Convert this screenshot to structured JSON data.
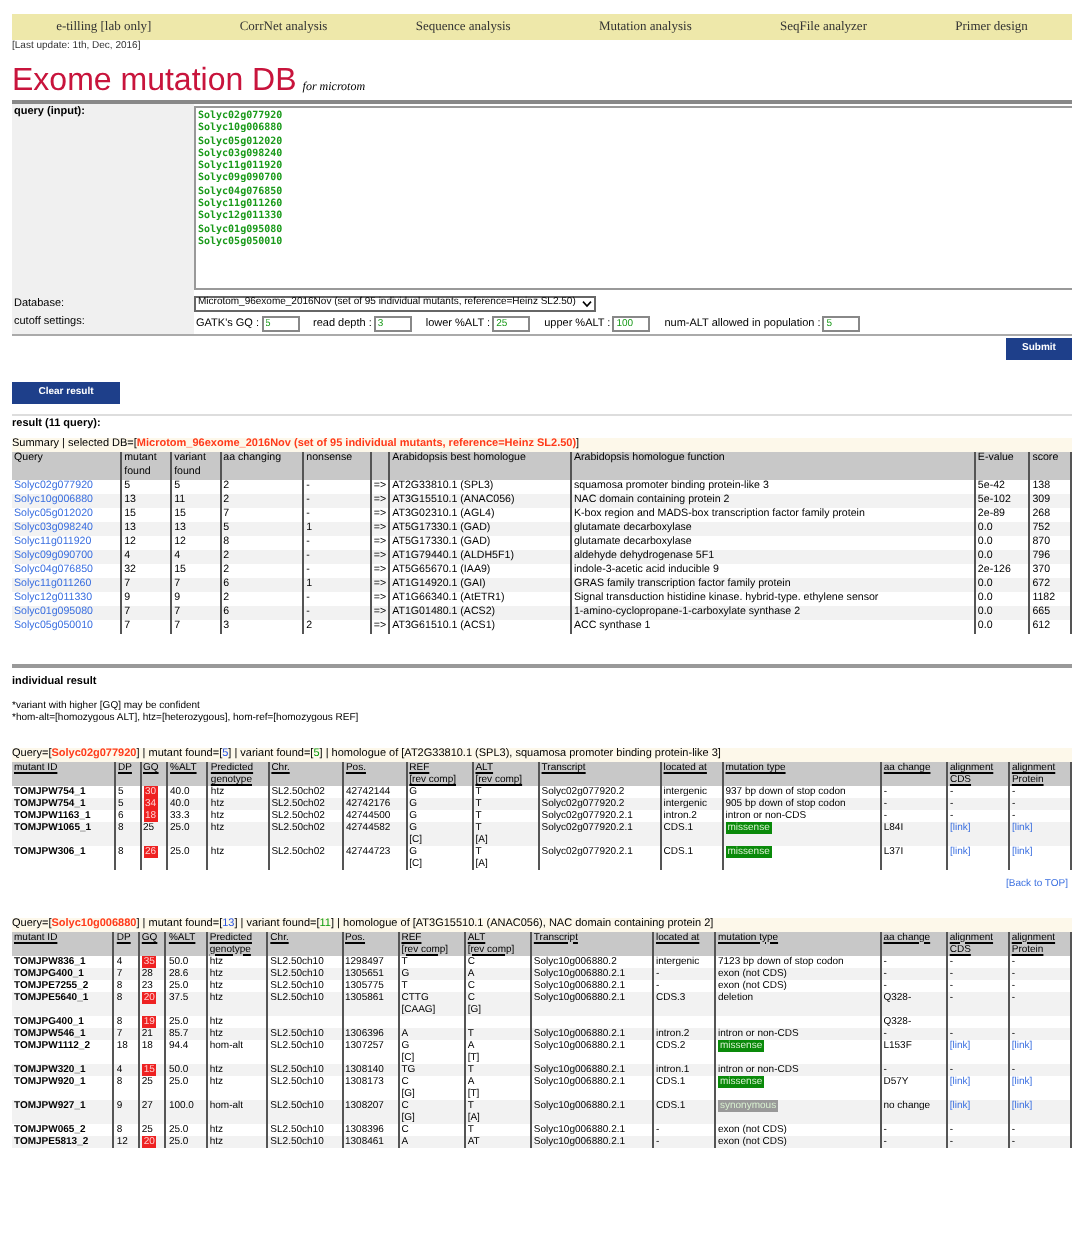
{
  "nav": [
    "e-tilling [lab only]",
    "CorrNet analysis",
    "Sequence analysis",
    "Mutation analysis",
    "SeqFile analyzer",
    "Primer design"
  ],
  "last_update": "[Last update: 1th, Dec, 2016]",
  "title": "Exome mutation DB",
  "subtitle": "for microtom",
  "form": {
    "query_label": "query (input):",
    "query_value": "Solyc02g077920\nSolyc10g006880\nSolyc05g012020\nSolyc03g098240\nSolyc11g011920\nSolyc09g090700\nSolyc04g076850\nSolyc11g011260\nSolyc12g011330\nSolyc01g095080\nSolyc05g050010",
    "database_label": "Database:",
    "database_value": "Microtom_96exome_2016Nov (set of 95 individual mutants, reference=Heinz SL2.50)",
    "cutoff_label": "cutoff settings:",
    "cutoffs": [
      {
        "label": "GATK's GQ :",
        "value": "5"
      },
      {
        "label": "read depth :",
        "value": "3"
      },
      {
        "label": "lower %ALT :",
        "value": "25"
      },
      {
        "label": "upper %ALT :",
        "value": "100"
      },
      {
        "label": "num-ALT allowed in population :",
        "value": "5"
      }
    ],
    "submit": "Submit"
  },
  "clear_button": "Clear result",
  "result_heading": "result (11 query):",
  "summary": {
    "heading": [
      {
        "kind": "plain",
        "text": "Summary | selected DB=["
      },
      {
        "kind": "db",
        "text": "Microtom_96exome_2016Nov (set of 95 individual mutants, reference=Heinz SL2.50)"
      },
      {
        "kind": "plain",
        "text": "]"
      }
    ],
    "columns": [
      "Query",
      "mutant\nfound",
      "variant\nfound",
      "aa changing",
      "nonsense",
      null,
      "Arabidopsis best homologue",
      "Arabidopsis homologue function",
      "E-value",
      "score"
    ],
    "rows": [
      [
        "Solyc02g077920",
        "5",
        "5",
        "2",
        "-",
        "=>",
        "AT2G33810.1 (SPL3)",
        "squamosa promoter binding protein-like 3",
        "5e-42",
        "138"
      ],
      [
        "Solyc10g006880",
        "13",
        "11",
        "2",
        "-",
        "=>",
        "AT3G15510.1 (ANAC056)",
        "NAC domain containing protein 2",
        "5e-102",
        "309"
      ],
      [
        "Solyc05g012020",
        "15",
        "15",
        "7",
        "-",
        "=>",
        "AT3G02310.1 (AGL4)",
        "K-box region and MADS-box transcription factor family protein",
        "2e-89",
        "268"
      ],
      [
        "Solyc03g098240",
        "13",
        "13",
        "5",
        "1",
        "=>",
        "AT5G17330.1 (GAD)",
        "glutamate decarboxylase",
        "0.0",
        "752"
      ],
      [
        "Solyc11g011920",
        "12",
        "12",
        "8",
        "-",
        "=>",
        "AT5G17330.1 (GAD)",
        "glutamate decarboxylase",
        "0.0",
        "870"
      ],
      [
        "Solyc09g090700",
        "4",
        "4",
        "2",
        "-",
        "=>",
        "AT1G79440.1 (ALDH5F1)",
        "aldehyde dehydrogenase 5F1",
        "0.0",
        "796"
      ],
      [
        "Solyc04g076850",
        "32",
        "15",
        "2",
        "-",
        "=>",
        "AT5G65670.1 (IAA9)",
        "indole-3-acetic acid inducible 9",
        "2e-126",
        "370"
      ],
      [
        "Solyc11g011260",
        "7",
        "7",
        "6",
        "1",
        "=>",
        "AT1G14920.1 (GAI)",
        "GRAS family transcription factor family protein",
        "0.0",
        "672"
      ],
      [
        "Solyc12g011330",
        "9",
        "9",
        "2",
        "-",
        "=>",
        "AT1G66340.1 (AtETR1)",
        "Signal transduction histidine kinase. hybrid-type. ethylene sensor",
        "0.0",
        "1182"
      ],
      [
        "Solyc01g095080",
        "7",
        "7",
        "6",
        "-",
        "=>",
        "AT1G01480.1 (ACS2)",
        "1-amino-cyclopropane-1-carboxylate synthase 2",
        "0.0",
        "665"
      ],
      [
        "Solyc05g050010",
        "7",
        "7",
        "3",
        "2",
        "=>",
        "AT3G61510.1 (ACS1)",
        "ACC synthase 1",
        "0.0",
        "612"
      ]
    ]
  },
  "individual": {
    "heading": "individual result",
    "notes": [
      "*variant with higher [GQ] may be confident",
      "*hom-alt=[homozygous ALT], htz=[heterozygous], hom-ref=[homozygous REF]"
    ]
  },
  "queries": [
    {
      "heading": [
        {
          "kind": "plain",
          "text": "Query=["
        },
        {
          "kind": "query",
          "text": "Solyc02g077920"
        },
        {
          "kind": "plain",
          "text": "] | mutant found=["
        },
        {
          "kind": "mutant",
          "text": "5"
        },
        {
          "kind": "plain",
          "text": "] | variant found=["
        },
        {
          "kind": "variant",
          "text": "5"
        },
        {
          "kind": "plain",
          "text": "] | homologue of [AT2G33810.1 (SPL3), squamosa promoter binding protein-like 3]"
        }
      ],
      "columns": [
        "mutant ID",
        "DP",
        "GQ",
        "%ALT",
        "Predicted\ngenotype",
        "Chr.",
        "Pos.",
        "REF\n[rev comp]",
        "ALT\n[rev comp]",
        "Transcript",
        "located at",
        "mutation type",
        "aa change",
        "alignment\nCDS",
        "alignment\nProtein"
      ],
      "rows": [
        {
          "cells": [
            "TOMJPW754_1",
            "5",
            "30",
            "40.0",
            "htz",
            "SL2.50ch02",
            "42742144",
            "G",
            "T",
            "Solyc02g077920.2",
            "intergenic",
            "937 bp down of stop codon",
            "-",
            "-",
            "-"
          ],
          "gq_low": true
        },
        {
          "cells": [
            "TOMJPW754_1",
            "5",
            "34",
            "40.0",
            "htz",
            "SL2.50ch02",
            "42742176",
            "G",
            "T",
            "Solyc02g077920.2",
            "intergenic",
            "905 bp down of stop codon",
            "-",
            "-",
            "-"
          ],
          "gq_low": true
        },
        {
          "cells": [
            "TOMJPW1163_1",
            "6",
            "18",
            "33.3",
            "htz",
            "SL2.50ch02",
            "42744500",
            "G",
            "T",
            "Solyc02g077920.2.1",
            "intron.2",
            "intron or non-CDS",
            "-",
            "-",
            "-"
          ],
          "gq_low": true
        },
        {
          "cells": [
            "TOMJPW1065_1",
            "8",
            "25",
            "25.0",
            "htz",
            "SL2.50ch02",
            "42744582",
            "G\n[C]",
            "T\n[A]",
            "Solyc02g077920.2.1",
            "CDS.1",
            "missense",
            "L84I"
          ],
          "links": [
            "[link]",
            "[link]"
          ],
          "gq_low": false,
          "color": "#0a8a0a"
        },
        {
          "cells": [
            "TOMJPW306_1",
            "8",
            "26",
            "25.0",
            "htz",
            "SL2.50ch02",
            "42744723",
            "G\n[C]",
            "T\n[A]",
            "Solyc02g077920.2.1",
            "CDS.1",
            "missense",
            "L37I"
          ],
          "links": [
            "[link]",
            "[link]"
          ],
          "gq_low": true,
          "color": "#0a8a0a"
        }
      ],
      "back_link": "[Back to TOP]"
    },
    {
      "heading": [
        {
          "kind": "plain",
          "text": "Query=["
        },
        {
          "kind": "query",
          "text": "Solyc10g006880"
        },
        {
          "kind": "plain",
          "text": "] | mutant found=["
        },
        {
          "kind": "mutant",
          "text": "13"
        },
        {
          "kind": "plain",
          "text": "] | variant found=["
        },
        {
          "kind": "variant",
          "text": "11"
        },
        {
          "kind": "plain",
          "text": "] | homologue of [AT3G15510.1 (ANAC056), NAC domain containing protein 2]"
        }
      ],
      "columns": [
        "mutant ID",
        "DP",
        "GQ",
        "%ALT",
        "Predicted\ngenotype",
        "Chr.",
        "Pos.",
        "REF\n[rev comp]",
        "ALT\n[rev comp]",
        "Transcript",
        "located at",
        "mutation type",
        "aa change",
        "alignment\nCDS",
        "alignment\nProtein"
      ],
      "rows": [
        {
          "cells": [
            "TOMJPW836_1",
            "4",
            "35",
            "50.0",
            "htz",
            "SL2.50ch10",
            "1298497",
            "T",
            "C",
            "Solyc10g006880.2",
            "intergenic",
            "7123 bp down of stop codon",
            "-",
            "-",
            "-"
          ],
          "gq_low": true
        },
        {
          "cells": [
            "TOMJPG400_1",
            "7",
            "28",
            "28.6",
            "htz",
            "SL2.50ch10",
            "1305651",
            "G",
            "A",
            "Solyc10g006880.2.1",
            "-",
            "exon (not CDS)",
            "-",
            "-",
            "-"
          ],
          "gq_low": false
        },
        {
          "cells": [
            "TOMJPE7255_2",
            "8",
            "23",
            "25.0",
            "htz",
            "SL2.50ch10",
            "1305775",
            "T",
            "C",
            "Solyc10g006880.2.1",
            "-",
            "exon (not CDS)",
            "-",
            "-",
            "-"
          ],
          "gq_low": false
        },
        {
          "cells": [
            "TOMJPE5640_1",
            "8",
            "20",
            "37.5",
            "htz",
            "SL2.50ch10",
            "1305861",
            "CTTG\n[CAAG]",
            "C\n[G]",
            "Solyc10g006880.2.1",
            "CDS.3",
            "deletion",
            "Q328-",
            "-",
            "-"
          ],
          "gq_low": true
        },
        {
          "cells": [
            "TOMJPG400_1",
            "8",
            "19",
            "25.0",
            "htz",
            null,
            null,
            null,
            null,
            null,
            null,
            null,
            "Q328-",
            null,
            null
          ],
          "gq_low": true
        },
        {
          "cells": [
            "TOMJPW546_1",
            "7",
            "21",
            "85.7",
            "htz",
            "SL2.50ch10",
            "1306396",
            "A",
            "T",
            "Solyc10g006880.2.1",
            "intron.2",
            "intron or non-CDS",
            "-",
            "-",
            "-"
          ],
          "gq_low": false
        },
        {
          "cells": [
            "TOMJPW1112_2",
            "18",
            "18",
            "94.4",
            "hom-alt",
            "SL2.50ch10",
            "1307257",
            "G\n[C]",
            "A\n[T]",
            "Solyc10g006880.2.1",
            "CDS.2",
            "missense",
            "L153F"
          ],
          "links": [
            "[link]",
            "[link]"
          ],
          "gq_low": false,
          "color": "#0a8a0a"
        },
        {
          "cells": [
            "TOMJPW320_1",
            "4",
            "15",
            "50.0",
            "htz",
            "SL2.50ch10",
            "1308140",
            "TG",
            "T",
            "Solyc10g006880.2.1",
            "intron.1",
            "intron or non-CDS",
            "-",
            "-",
            "-"
          ],
          "gq_low": true
        },
        {
          "cells": [
            "TOMJPW920_1",
            "8",
            "25",
            "25.0",
            "htz",
            "SL2.50ch10",
            "1308173",
            "C\n[G]",
            "A\n[T]",
            "Solyc10g006880.2.1",
            "CDS.1",
            "missense",
            "D57Y"
          ],
          "links": [
            "[link]",
            "[link]"
          ],
          "gq_low": false,
          "color": "#0a8a0a"
        },
        {
          "cells": [
            "TOMJPW927_1",
            "9",
            "27",
            "100.0",
            "hom-alt",
            "SL2.50ch10",
            "1308207",
            "C\n[G]",
            "T\n[A]",
            "Solyc10g006880.2.1",
            "CDS.1",
            "synonymous",
            "no change"
          ],
          "links": [
            "[link]",
            "[link]"
          ],
          "gq_low": false,
          "color": "#999999"
        },
        {
          "cells": [
            "TOMJPW065_2",
            "8",
            "25",
            "25.0",
            "htz",
            "SL2.50ch10",
            "1308396",
            "C",
            "T",
            "Solyc10g006880.2.1",
            "-",
            "exon (not CDS)",
            "-",
            "-",
            "-"
          ],
          "gq_low": false
        },
        {
          "cells": [
            "TOMJPE5813_2",
            "12",
            "20",
            "25.0",
            "htz",
            "SL2.50ch10",
            "1308461",
            "A",
            "AT",
            "Solyc10g006880.2.1",
            "-",
            "exon (not CDS)",
            "-",
            "-",
            "-"
          ],
          "gq_low": true
        }
      ]
    }
  ]
}
